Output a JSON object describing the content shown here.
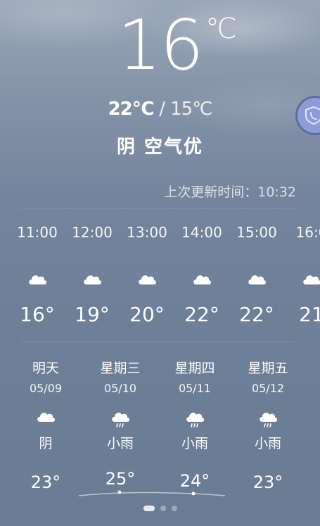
{
  "current": {
    "temperature": "16",
    "unit": "℃",
    "high": "22℃",
    "sep": "/",
    "low": "15℃",
    "condition": "阴 空气优",
    "updated_label": "上次更新时间：10:32"
  },
  "hourly": [
    {
      "time": "11:00",
      "icon": "cloud-icon",
      "temp": "16°"
    },
    {
      "time": "12:00",
      "icon": "cloud-icon",
      "temp": "19°"
    },
    {
      "time": "13:00",
      "icon": "cloud-icon",
      "temp": "20°"
    },
    {
      "time": "14:00",
      "icon": "cloud-icon",
      "temp": "22°"
    },
    {
      "time": "15:00",
      "icon": "cloud-icon",
      "temp": "22°"
    },
    {
      "time": "16:0",
      "icon": "cloud-icon",
      "temp": "21"
    }
  ],
  "daily": [
    {
      "day": "明天",
      "date": "05/09",
      "icon": "cloud-icon",
      "cond": "阴",
      "temp": "23°"
    },
    {
      "day": "星期三",
      "date": "05/10",
      "icon": "rain-cloud-icon",
      "cond": "小雨",
      "temp": "25°"
    },
    {
      "day": "星期四",
      "date": "05/11",
      "icon": "rain-cloud-icon",
      "cond": "小雨",
      "temp": "24°"
    },
    {
      "day": "星期五",
      "date": "05/12",
      "icon": "rain-cloud-icon",
      "cond": "小雨",
      "temp": "23°"
    }
  ],
  "side_button": {
    "icon": "shield-phone-icon"
  },
  "pager": {
    "pages": 3,
    "active": 0
  },
  "colors": {
    "button_fill": "#8d9bd6",
    "button_border": "#5f6d9e"
  }
}
